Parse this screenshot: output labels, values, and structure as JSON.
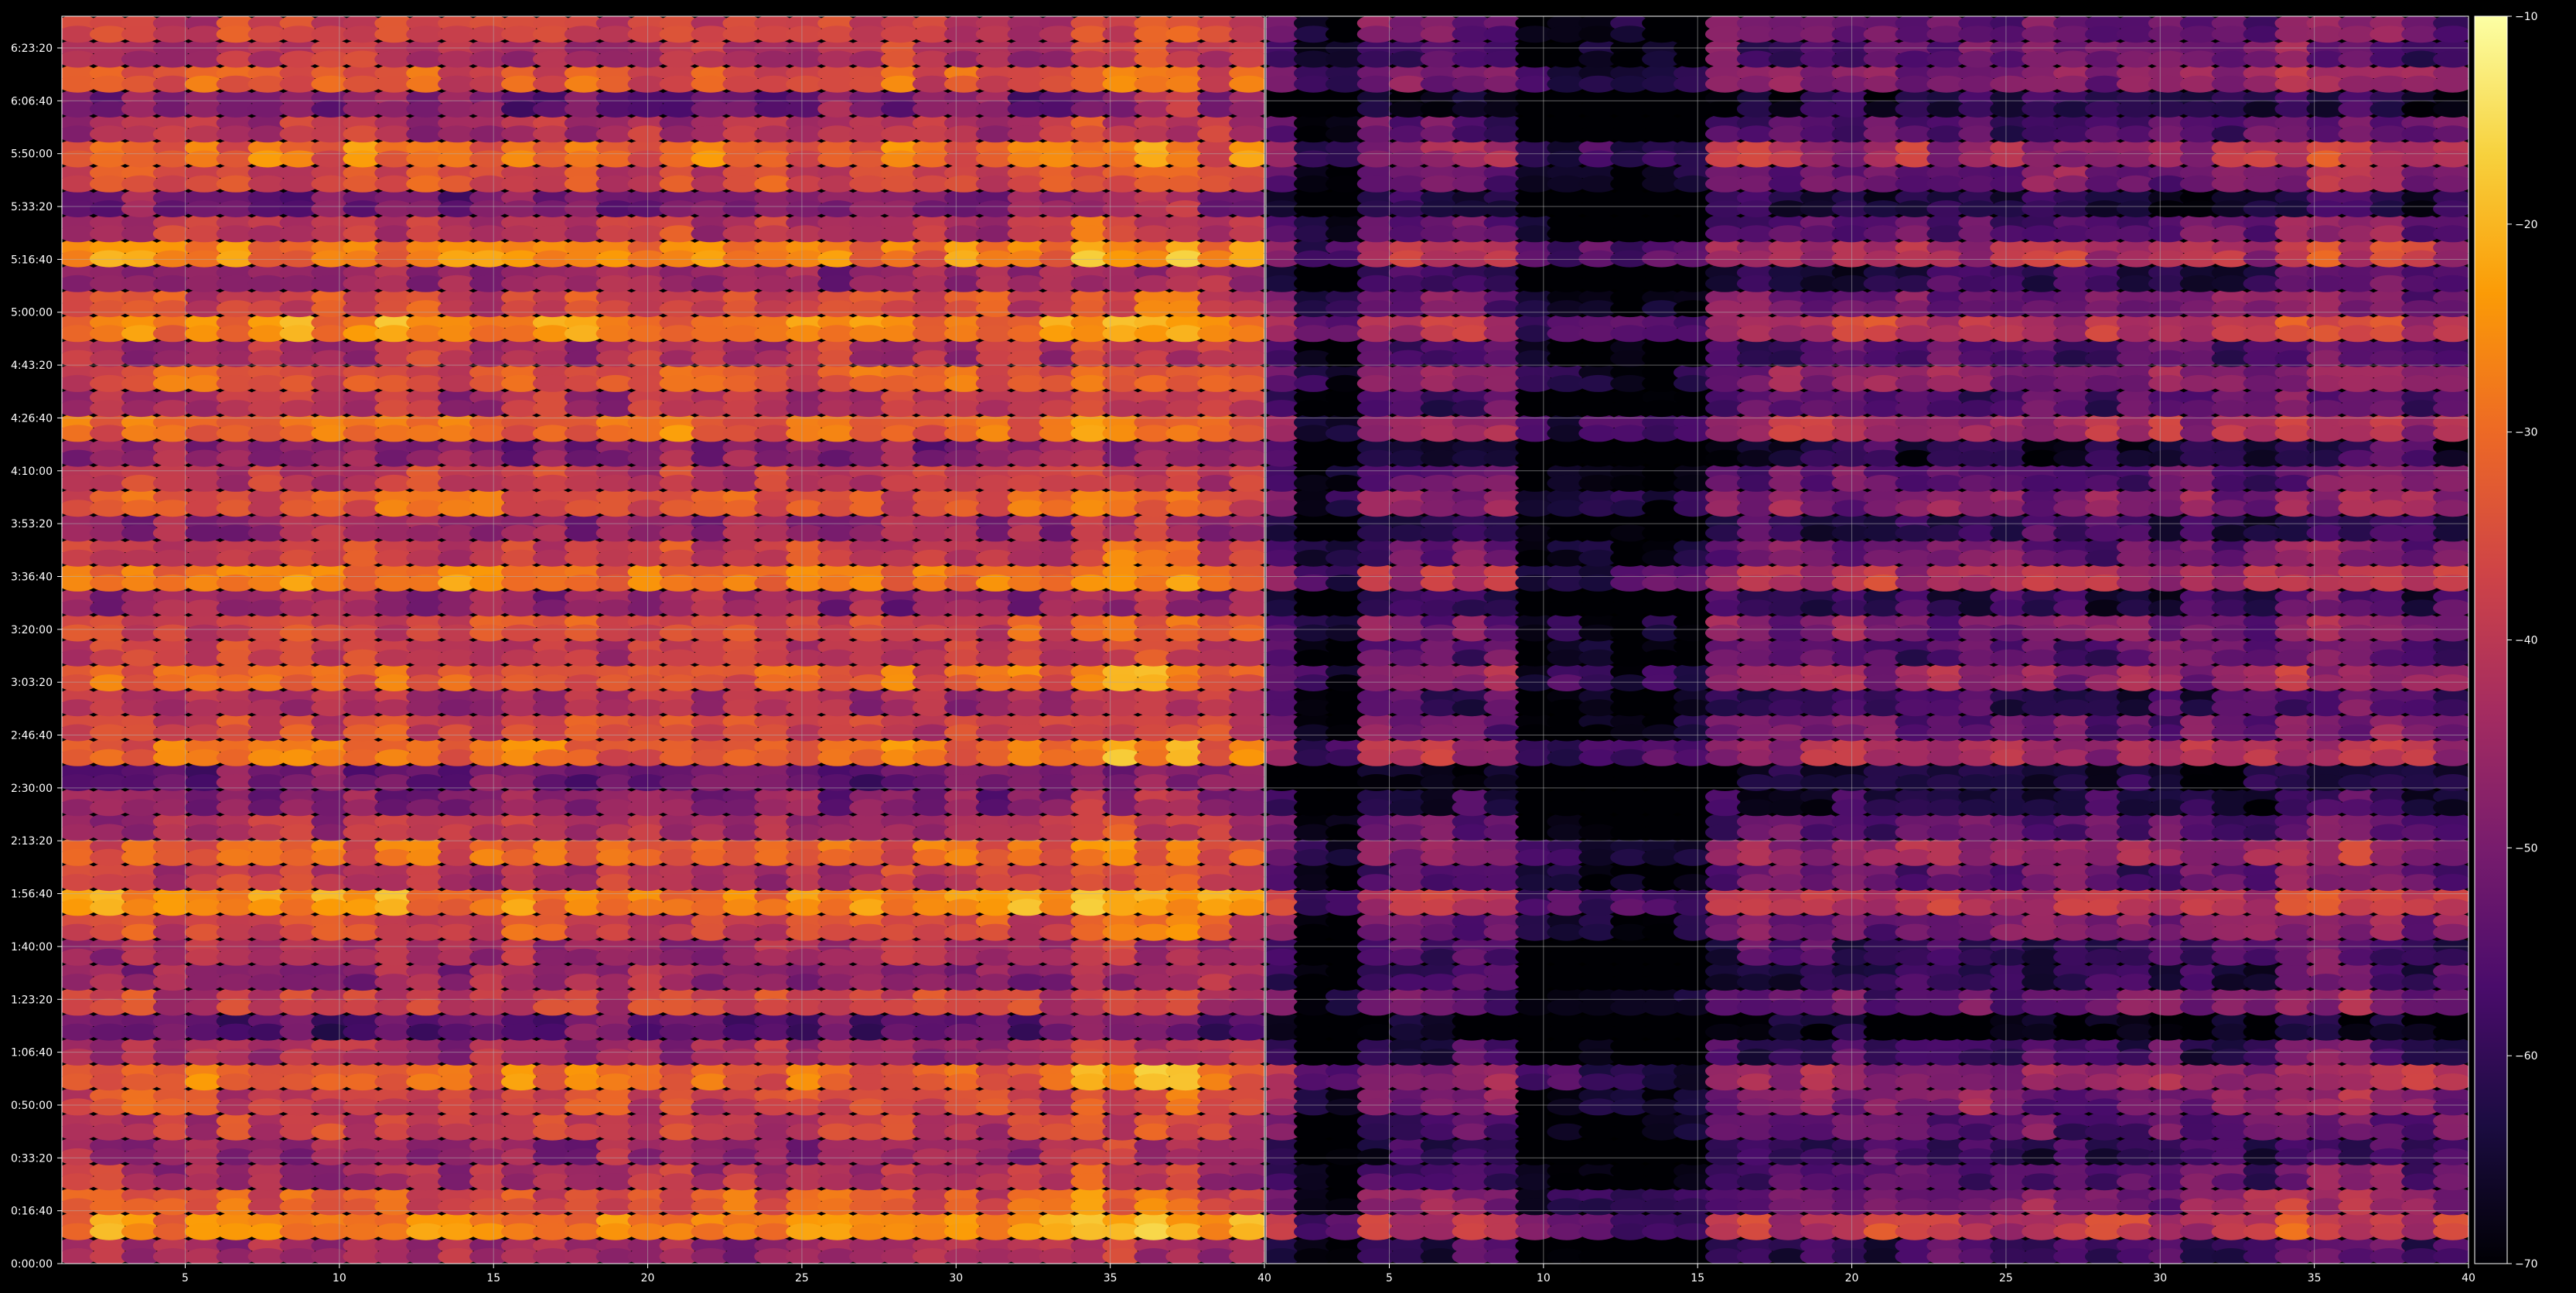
{
  "chart_data": {
    "type": "heatmap",
    "title": "",
    "xlabel": "",
    "ylabel": "",
    "grid": true,
    "colormap": "inferno",
    "colormap_stops": [
      "#000004",
      "#1b0c41",
      "#4a0c6b",
      "#781c6d",
      "#a52c60",
      "#cf4446",
      "#ed6925",
      "#fb9b06",
      "#f7d13d",
      "#fcffa4"
    ],
    "color_range": [
      -70,
      -10
    ],
    "background": "#000000",
    "panels": [
      {
        "name": "left",
        "x_range": [
          1,
          40
        ],
        "x_ticks": [
          5,
          10,
          15,
          20,
          25,
          30,
          35,
          40
        ],
        "x_tick_labels": [
          "5",
          "10",
          "15",
          "20",
          "25",
          "30",
          "35",
          "40"
        ]
      },
      {
        "name": "right",
        "x_range": [
          1,
          40
        ],
        "x_ticks": [
          5,
          10,
          15,
          20,
          25,
          30,
          35,
          40
        ],
        "x_tick_labels": [
          "5",
          "10",
          "15",
          "20",
          "25",
          "30",
          "35",
          "40"
        ]
      }
    ],
    "y_range_seconds": [
      0,
      23600
    ],
    "y_ticks_seconds": [
      0,
      1000,
      2000,
      3000,
      4000,
      5000,
      6000,
      7000,
      8000,
      9000,
      10000,
      11000,
      12000,
      13000,
      14000,
      15000,
      16000,
      17000,
      18000,
      19000,
      20000,
      21000,
      22000,
      23000
    ],
    "y_tick_labels": [
      "0:00:00",
      "0:16:40",
      "0:33:20",
      "0:50:00",
      "1:06:40",
      "1:23:20",
      "1:40:00",
      "1:56:40",
      "2:13:20",
      "2:30:00",
      "2:46:40",
      "3:03:20",
      "3:20:00",
      "3:36:40",
      "3:53:20",
      "4:10:00",
      "4:26:40",
      "4:43:20",
      "5:00:00",
      "5:16:40",
      "5:33:20",
      "5:50:00",
      "6:06:40",
      "6:23:20"
    ],
    "colorbar_ticks": [
      -10,
      -20,
      -30,
      -40,
      -50,
      -60,
      -70
    ],
    "colorbar_tick_labels": [
      "−10",
      "−20",
      "−30",
      "−40",
      "−50",
      "−60",
      "−70"
    ],
    "rows": 50,
    "cols_per_panel": 38,
    "row_levels": [
      -45,
      -26,
      -34,
      -42,
      -46,
      -40,
      -36,
      -30,
      -44,
      -54,
      -38,
      -46,
      -44,
      -36,
      -26,
      -40,
      -32,
      -42,
      -48,
      -52,
      -30,
      -38,
      -44,
      -32,
      -40,
      -36,
      -46,
      -28,
      -38,
      -46,
      -34,
      -40,
      -48,
      -30,
      -42,
      -34,
      -42,
      -26,
      -36,
      -46,
      -28,
      -40,
      -50,
      -36,
      -30,
      -42,
      -50,
      -34,
      -40,
      -38
    ],
    "right_panel_offset": -14,
    "right_panel_dark_columns": [
      [
        1,
        2
      ],
      [
        8,
        13
      ]
    ]
  }
}
